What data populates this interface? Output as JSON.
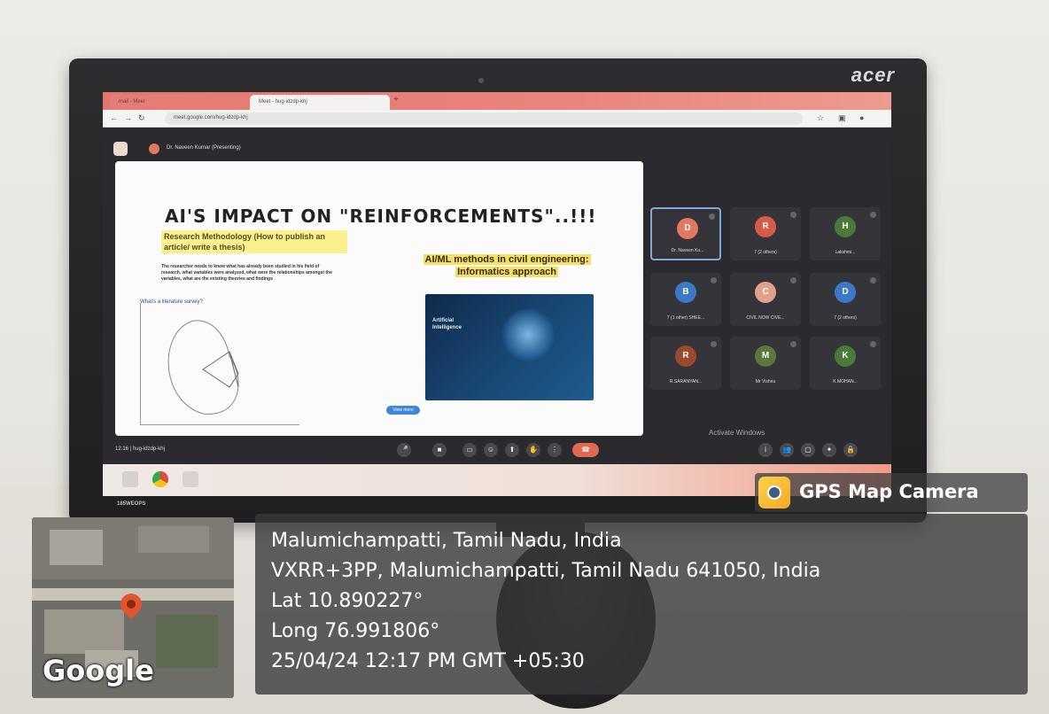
{
  "monitor": {
    "brand": "acer",
    "model": "185WEOPS"
  },
  "browser": {
    "tabs": [
      {
        "label": "mail - Meet"
      },
      {
        "label": "Meet - hug-idzdp-khj"
      }
    ],
    "url": "meet.google.com/hug-idzdp-khj"
  },
  "meet": {
    "presenter": "Dr. Naveen Kumar (Presenting)",
    "time": "12:16 | hug-idzdp-khj",
    "activate_windows": "Activate Windows",
    "participants": [
      {
        "name": "Dr. Naveen Ku...",
        "initial": "D",
        "color": "#e0795f"
      },
      {
        "name": "7 (2 others)",
        "initial": "R",
        "color": "#d85b4a"
      },
      {
        "name": "Lakshmi...",
        "initial": "H",
        "color": "#4a7a3a"
      },
      {
        "name": "7 (1 other) SHEE...",
        "initial": "B",
        "color": "#3b78c8"
      },
      {
        "name": "CIVIL NOW CIVE...",
        "initial": "C",
        "color": "#e0a28a"
      },
      {
        "name": "7 (2 others)",
        "initial": "D",
        "color": "#3b78c8"
      },
      {
        "name": "R.SARANYAN...",
        "initial": "R",
        "color": "#9a4a2a"
      },
      {
        "name": "Mr Vishnu",
        "initial": "M",
        "color": "#5a7a3a"
      },
      {
        "name": "K.MOHAN...",
        "initial": "K",
        "color": "#4a7a3a"
      }
    ]
  },
  "slide": {
    "title": "AI'S IMPACT ON \"REINFORCEMENTS\"..!!!",
    "subtitle": "Research Methodology (How to publish an article/ write a thesis)",
    "body": "The researcher needs to know what has already been studied in his field of research, what variables were analyzed, what were the relationships amongst the variables, what are the existing theories and findings",
    "methods_line1": "AI/ML methods in civil engineering:",
    "methods_line2": "Informatics approach",
    "note": "What's a literature survey?",
    "panel_title": "Artificial Intelligence",
    "button": "View more"
  },
  "gps": {
    "app_name": "GPS Map Camera",
    "place": "Malumichampatti, Tamil Nadu, India",
    "address": "VXRR+3PP, Malumichampatti, Tamil Nadu 641050, India",
    "lat": "Lat 10.890227°",
    "long": "Long 76.991806°",
    "datetime": "25/04/24 12:17 PM GMT +05:30",
    "map_label": "Google"
  }
}
